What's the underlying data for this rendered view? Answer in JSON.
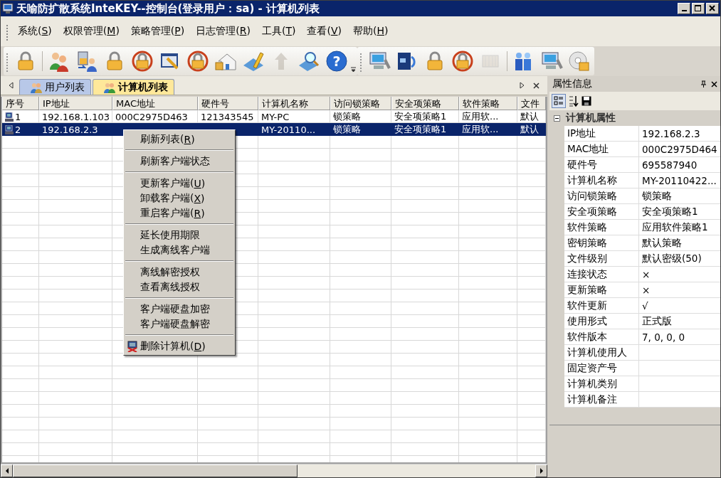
{
  "window": {
    "title": "天喻防扩散系统InteKEY--控制台(登录用户：sa) - 计算机列表"
  },
  "menu_bar": [
    {
      "text": "系统(",
      "key": "S",
      "end": ")"
    },
    {
      "text": "权限管理(",
      "key": "M",
      "end": ")"
    },
    {
      "text": "策略管理(",
      "key": "P",
      "end": ")"
    },
    {
      "text": "日志管理(",
      "key": "R",
      "end": ")"
    },
    {
      "text": "工具(",
      "key": "T",
      "end": ")"
    },
    {
      "text": "查看(",
      "key": "V",
      "end": ")"
    },
    {
      "text": "帮助(",
      "key": "H",
      "end": ")"
    }
  ],
  "toolbars": [
    {
      "items": [
        {
          "kind": "lock",
          "disabled": false
        },
        {
          "kind": "separator"
        },
        {
          "kind": "users",
          "disabled": false
        },
        {
          "kind": "user-transfer",
          "disabled": false
        },
        {
          "kind": "lock",
          "disabled": false
        },
        {
          "kind": "lock-ring",
          "disabled": false
        },
        {
          "kind": "tools",
          "disabled": false
        },
        {
          "kind": "lock-ring",
          "disabled": false
        },
        {
          "kind": "home",
          "disabled": false
        },
        {
          "kind": "pencil",
          "disabled": false
        },
        {
          "kind": "upload",
          "disabled": true
        },
        {
          "kind": "search",
          "disabled": false
        },
        {
          "kind": "help",
          "glyph": "?",
          "disabled": false
        }
      ]
    },
    {
      "items": [
        {
          "kind": "computer",
          "disabled": false
        },
        {
          "kind": "server",
          "disabled": false
        },
        {
          "kind": "lock",
          "disabled": false
        },
        {
          "kind": "lock-ring",
          "disabled": false
        },
        {
          "kind": "stamp",
          "disabled": true
        },
        {
          "kind": "separator"
        },
        {
          "kind": "network",
          "disabled": false
        },
        {
          "kind": "computer",
          "disabled": false
        },
        {
          "kind": "disc",
          "disabled": false
        }
      ]
    }
  ],
  "tabs": [
    {
      "label": "用户列表",
      "selected": false
    },
    {
      "label": "计算机列表",
      "selected": true
    }
  ],
  "table": {
    "columns": [
      "序号",
      "IP地址",
      "MAC地址",
      "硬件号",
      "计算机名称",
      "访问锁策略",
      "安全项策略",
      "软件策略",
      "文件"
    ],
    "rows": [
      {
        "selected": false,
        "cells": [
          "1",
          "192.168.1.103",
          "000C2975D463",
          "121343545",
          "MY-PC",
          "锁策略",
          "安全项策略1",
          "应用软...",
          "默认"
        ]
      },
      {
        "selected": true,
        "cells": [
          "2",
          "192.168.2.3",
          "",
          "",
          "MY-20110...",
          "锁策略",
          "安全项策略1",
          "应用软...",
          "默认"
        ]
      }
    ]
  },
  "context_menu": [
    {
      "kind": "item",
      "text": "刷新列表(",
      "key": "R",
      "end": ")"
    },
    {
      "kind": "separator"
    },
    {
      "kind": "item",
      "text": "刷新客户端状态"
    },
    {
      "kind": "separator"
    },
    {
      "kind": "item",
      "text": "更新客户端(",
      "key": "U",
      "end": ")"
    },
    {
      "kind": "item",
      "text": "卸载客户端(",
      "key": "X",
      "end": ")"
    },
    {
      "kind": "item",
      "text": "重启客户端(",
      "key": "R",
      "end": ")"
    },
    {
      "kind": "separator"
    },
    {
      "kind": "item",
      "text": "延长使用期限"
    },
    {
      "kind": "item",
      "text": "生成离线客户端"
    },
    {
      "kind": "separator"
    },
    {
      "kind": "item",
      "text": "离线解密授权"
    },
    {
      "kind": "item",
      "text": "查看离线授权"
    },
    {
      "kind": "separator"
    },
    {
      "kind": "item",
      "text": "客户端硬盘加密"
    },
    {
      "kind": "item",
      "text": "客户端硬盘解密"
    },
    {
      "kind": "separator"
    },
    {
      "kind": "delete",
      "text": "删除计算机(",
      "key": "D",
      "end": ")"
    }
  ],
  "properties": {
    "title": "属性信息",
    "category": {
      "label": "计算机属性",
      "expanded": true
    },
    "rows": [
      {
        "label": "IP地址",
        "value": "192.168.2.3"
      },
      {
        "label": "MAC地址",
        "value": "000C2975D464"
      },
      {
        "label": "硬件号",
        "value": "695587940"
      },
      {
        "label": "计算机名称",
        "value": "MY-20110422..."
      },
      {
        "label": "访问锁策略",
        "value": "锁策略"
      },
      {
        "label": "安全项策略",
        "value": "安全项策略1"
      },
      {
        "label": "软件策略",
        "value": "应用软件策略1"
      },
      {
        "label": "密钥策略",
        "value": "默认策略"
      },
      {
        "label": "文件级别",
        "value": "默认密级(50)"
      },
      {
        "label": "连接状态",
        "value": "×"
      },
      {
        "label": "更新策略",
        "value": "×"
      },
      {
        "label": "软件更新",
        "value": "√"
      },
      {
        "label": "使用形式",
        "value": "正式版"
      },
      {
        "label": "软件版本",
        "value": "7, 0, 0, 0"
      },
      {
        "label": "计算机使用人"
      },
      {
        "label": "固定资产号"
      },
      {
        "label": "计算机类别"
      },
      {
        "label": "计算机备注"
      }
    ]
  }
}
